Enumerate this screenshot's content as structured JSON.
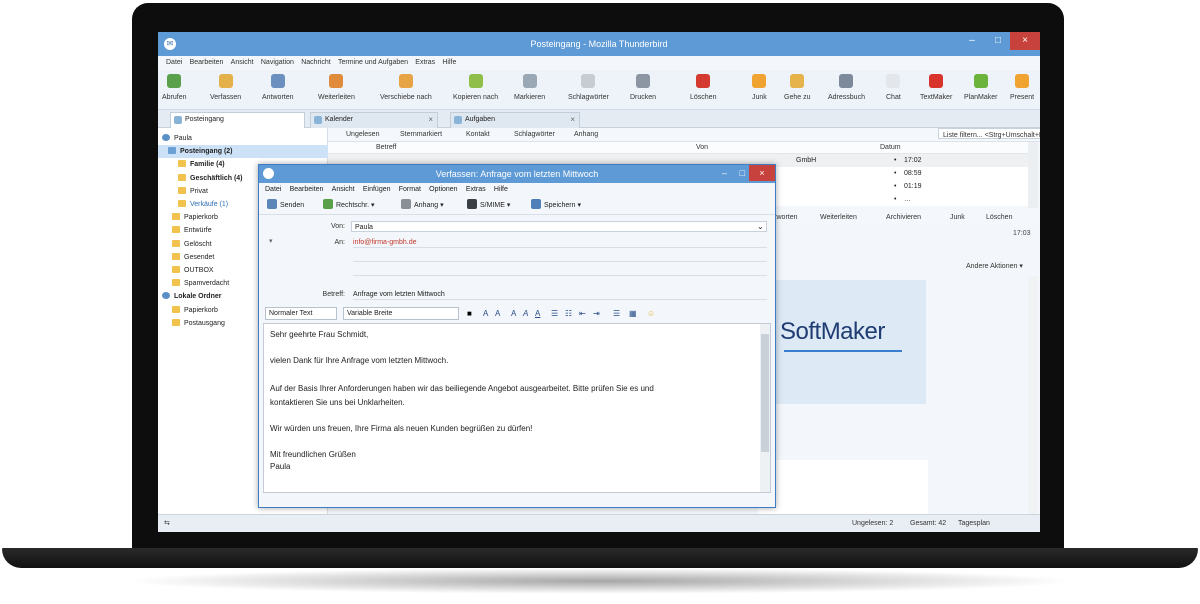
{
  "window": {
    "title": "Posteingang - Mozilla Thunderbird",
    "controls": {
      "minimize": "–",
      "maximize": "□",
      "close": "×"
    }
  },
  "menu": [
    "Datei",
    "Bearbeiten",
    "Ansicht",
    "Navigation",
    "Nachricht",
    "Termine und Aufgaben",
    "Extras",
    "Hilfe"
  ],
  "toolbar": [
    {
      "label": "Abrufen",
      "icon": "download-icon",
      "color": "#5aa04a"
    },
    {
      "label": "Verfassen",
      "icon": "compose-icon",
      "color": "#e3b04a"
    },
    {
      "label": "Antworten",
      "icon": "reply-icon",
      "color": "#6b8fbf"
    },
    {
      "label": "Weiterleiten",
      "icon": "forward-icon",
      "color": "#e08a3c"
    },
    {
      "label": "Verschiebe nach",
      "icon": "move-icon",
      "color": "#e6a445"
    },
    {
      "label": "Kopieren nach",
      "icon": "copy-icon",
      "color": "#8fbf4a"
    },
    {
      "label": "Markieren",
      "icon": "mark-icon",
      "color": "#9aa7b5"
    },
    {
      "label": "Schlagwörter",
      "icon": "tag-icon",
      "color": "#c7ccd2"
    },
    {
      "label": "Drucken",
      "icon": "print-icon",
      "color": "#8c96a3"
    },
    {
      "label": "Löschen",
      "icon": "delete-icon",
      "color": "#d43a2f"
    },
    {
      "label": "Junk",
      "icon": "junk-icon",
      "color": "#f0a330"
    },
    {
      "label": "Gehe zu",
      "icon": "goto-icon",
      "color": "#e6b24a"
    },
    {
      "label": "Adressbuch",
      "icon": "addressbook-icon",
      "color": "#7c8a9c"
    },
    {
      "label": "Chat",
      "icon": "chat-icon",
      "color": "#e3e7ec"
    },
    {
      "label": "TextMaker",
      "icon": "textmaker-icon",
      "color": "#d9342b"
    },
    {
      "label": "PlanMaker",
      "icon": "planmaker-icon",
      "color": "#6bb33a"
    },
    {
      "label": "Present",
      "icon": "presentations-icon",
      "color": "#f0a330"
    }
  ],
  "tabs": [
    {
      "label": "Posteingang",
      "active": true
    },
    {
      "label": "Kalender",
      "active": false
    },
    {
      "label": "Aufgaben",
      "active": false
    }
  ],
  "folders": [
    {
      "label": "Paula",
      "type": "acct"
    },
    {
      "label": "Posteingang (2)",
      "type": "inbox",
      "selected": true,
      "bold": true
    },
    {
      "label": "Familie (4)",
      "type": "folder",
      "bold": true
    },
    {
      "label": "Geschäftlich (4)",
      "type": "folder",
      "bold": true
    },
    {
      "label": "Privat",
      "type": "folder"
    },
    {
      "label": "Verkäufe (1)",
      "type": "folder",
      "accent": true
    },
    {
      "label": "Papierkorb",
      "type": "folder"
    },
    {
      "label": "Entwürfe",
      "type": "folder"
    },
    {
      "label": "Gelöscht",
      "type": "folder"
    },
    {
      "label": "Gesendet",
      "type": "folder"
    },
    {
      "label": "OUTBOX",
      "type": "folder"
    },
    {
      "label": "Spamverdacht",
      "type": "folder"
    },
    {
      "label": "Lokale Ordner",
      "type": "acct",
      "bold": true
    },
    {
      "label": "Papierkorb",
      "type": "folder"
    },
    {
      "label": "Postausgang",
      "type": "folder"
    }
  ],
  "quickfilter": {
    "items": [
      "Ungelesen",
      "Sternmarkiert",
      "Kontakt",
      "Schlagwörter",
      "Anhang"
    ],
    "search_placeholder": "Liste filtern... <Strg+Umschalt+K>"
  },
  "list": {
    "headers": {
      "subject": "Betreff",
      "from": "Von",
      "date": "Datum"
    },
    "rows": [
      {
        "from": "GmbH",
        "date": "17:02",
        "selected": true
      },
      {
        "from": "",
        "date": "08:59"
      },
      {
        "from": "",
        "date": "01:19"
      },
      {
        "from": "",
        "date": "…"
      }
    ]
  },
  "preview": {
    "buttons": [
      "Antworten",
      "Weiterleiten",
      "Archivieren",
      "Junk",
      "Löschen"
    ],
    "time": "17:03",
    "sender_menu": "Andere Aktionen ▾",
    "banner": "SoftMaker"
  },
  "compose": {
    "title": "Verfassen: Anfrage vom letzten Mittwoch",
    "menu": [
      "Datei",
      "Bearbeiten",
      "Ansicht",
      "Einfügen",
      "Format",
      "Optionen",
      "Extras",
      "Hilfe"
    ],
    "toolbar": [
      {
        "label": "Senden",
        "icon": "send-icon",
        "color": "#5b86b8"
      },
      {
        "label": "Rechtschr.",
        "icon": "spellcheck-icon",
        "color": "#5aa04a"
      },
      {
        "label": "Anhang",
        "icon": "attachment-icon",
        "color": "#8a8f96"
      },
      {
        "label": "S/MIME",
        "icon": "lock-icon",
        "color": "#3a3f46"
      },
      {
        "label": "Speichern",
        "icon": "save-icon",
        "color": "#4d7fb8"
      }
    ],
    "from_label": "Von:",
    "from_value": "Paula",
    "to_label": "An:",
    "to_value": "info@firma-gmbh.de",
    "subject_label": "Betreff:",
    "subject_value": "Anfrage vom letzten Mittwoch",
    "paragraph_style": "Normaler Text",
    "font": "Variable Breite",
    "body": [
      "Sehr geehrte Frau Schmidt,",
      "vielen Dank für Ihre Anfrage vom letzten Mittwoch.",
      "Auf der Basis Ihrer Anforderungen haben wir das beiliegende Angebot ausgearbeitet. Bitte prüfen Sie es und",
      "kontaktieren Sie uns bei Unklarheiten.",
      "Wir würden uns freuen, Ihre Firma als neuen Kunden begrüßen zu dürfen!",
      "Mit freundlichen Grüßen",
      "Paula"
    ]
  },
  "status": {
    "unread": "Ungelesen: 2",
    "total": "Gesamt: 42",
    "today_pane": "Tagesplan"
  }
}
